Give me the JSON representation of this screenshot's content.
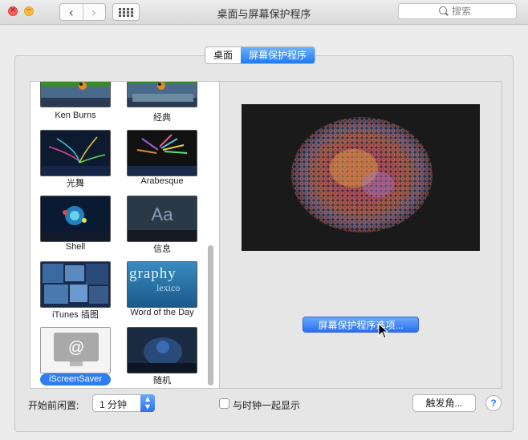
{
  "window": {
    "title": "桌面与屏幕保护程序",
    "search_placeholder": "搜索"
  },
  "toolbar": {
    "back_icon": "chevron-left-icon",
    "forward_icon": "chevron-right-icon",
    "grid_icon": "show-all-grid-icon"
  },
  "tabs": [
    {
      "label": "桌面",
      "active": false
    },
    {
      "label": "屏幕保护程序",
      "active": true
    }
  ],
  "screensavers": [
    {
      "label": "Ken Burns",
      "selected": false
    },
    {
      "label": "经典",
      "selected": false
    },
    {
      "label": "光舞",
      "selected": false
    },
    {
      "label": "Arabesque",
      "selected": false
    },
    {
      "label": "Shell",
      "selected": false
    },
    {
      "label": "信息",
      "selected": false
    },
    {
      "label": "iTunes 插图",
      "selected": false
    },
    {
      "label": "Word of the Day",
      "selected": false
    },
    {
      "label": "iScreenSaver",
      "selected": true
    },
    {
      "label": "随机",
      "selected": false
    }
  ],
  "thumbnails": {
    "message_text": "Aa",
    "word_text": "graphy",
    "word_sub": "lexico"
  },
  "preview": {
    "options_button": "屏幕保护程序选项..."
  },
  "bottom": {
    "start_label": "开始前闲置:",
    "start_value": "1 分钟",
    "clock_label": "与时钟一起显示",
    "clock_checked": false,
    "hot_corners_button": "触发角...",
    "help_button": "?"
  },
  "colors": {
    "accent": "#2f7ef1",
    "preview_bg": "#1a1a1a"
  }
}
